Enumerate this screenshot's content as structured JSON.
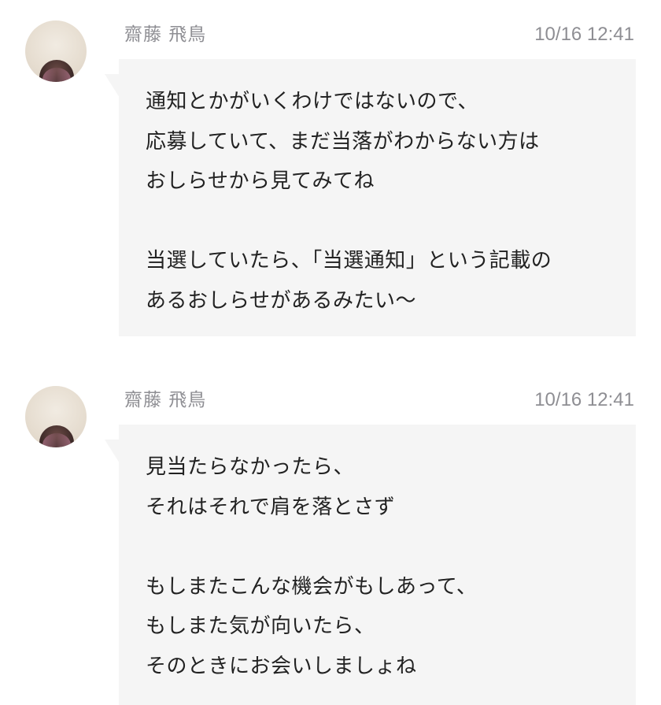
{
  "messages": [
    {
      "sender": "齋藤 飛鳥",
      "timestamp": "10/16 12:41",
      "lines": [
        "通知とかがいくわけではないので、",
        "応募していて、まだ当落がわからない方は",
        "おしらせから見てみてね",
        "",
        "当選していたら、「当選通知」という記載の",
        "あるおしらせがあるみたい〜"
      ]
    },
    {
      "sender": "齋藤 飛鳥",
      "timestamp": "10/16 12:41",
      "lines": [
        "見当たらなかったら、",
        "それはそれで肩を落とさず",
        "",
        "もしまたこんな機会がもしあって、",
        "もしまた気が向いたら、",
        "そのときにお会いしましょね"
      ]
    }
  ],
  "colors": {
    "background": "#ffffff",
    "bubble": "#f5f5f5",
    "meta_text": "#8e8e93",
    "body_text": "#222222"
  }
}
